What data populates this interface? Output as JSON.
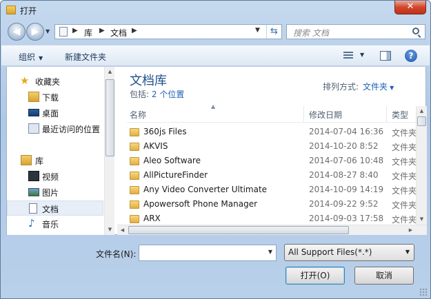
{
  "window": {
    "title": "打开",
    "close_label": "✕"
  },
  "navbar": {
    "back_label": "◀",
    "forward_label": "▶",
    "breadcrumb": [
      "库",
      "文档"
    ],
    "breadcrumb_sep": "▶",
    "search_placeholder": "搜索 文档"
  },
  "toolbar": {
    "organize_label": "组织",
    "new_folder_label": "新建文件夹",
    "help_label": "?"
  },
  "sidebar": {
    "favorites": [
      {
        "label": "收藏夹",
        "icon": "star-icon"
      },
      {
        "label": "下载",
        "icon": "downloads-folder-icon"
      },
      {
        "label": "桌面",
        "icon": "desktop-icon"
      },
      {
        "label": "最近访问的位置",
        "icon": "recent-places-icon"
      }
    ],
    "libraries": [
      {
        "label": "库",
        "icon": "library-icon"
      },
      {
        "label": "视频",
        "icon": "video-icon"
      },
      {
        "label": "图片",
        "icon": "picture-icon"
      },
      {
        "label": "文档",
        "icon": "document-icon",
        "selected": true
      },
      {
        "label": "音乐",
        "icon": "music-icon"
      }
    ]
  },
  "library": {
    "title": "文档库",
    "includes_label": "包括:",
    "locations_link": "2 个位置",
    "arrange_label": "排列方式:",
    "arrange_value": "文件夹"
  },
  "columns": {
    "name": "名称",
    "date": "修改日期",
    "type": "类型"
  },
  "files": [
    {
      "name": "360js Files",
      "date": "2014-07-04 16:36",
      "type": "文件夹"
    },
    {
      "name": "AKVIS",
      "date": "2014-10-20 8:52",
      "type": "文件夹"
    },
    {
      "name": "Aleo Software",
      "date": "2014-07-06 10:48",
      "type": "文件夹"
    },
    {
      "name": "AllPictureFinder",
      "date": "2014-08-27 8:40",
      "type": "文件夹"
    },
    {
      "name": "Any Video Converter Ultimate",
      "date": "2014-10-09 14:19",
      "type": "文件夹"
    },
    {
      "name": "Apowersoft Phone Manager",
      "date": "2014-09-22 9:52",
      "type": "文件夹"
    },
    {
      "name": "ARX",
      "date": "2014-09-03 17:58",
      "type": "文件夹"
    }
  ],
  "bottom": {
    "filename_label": "文件名(N):",
    "filename_value": "",
    "filter_value": "All Support Files(*.*)",
    "open_label": "打开(O)",
    "cancel_label": "取消"
  }
}
